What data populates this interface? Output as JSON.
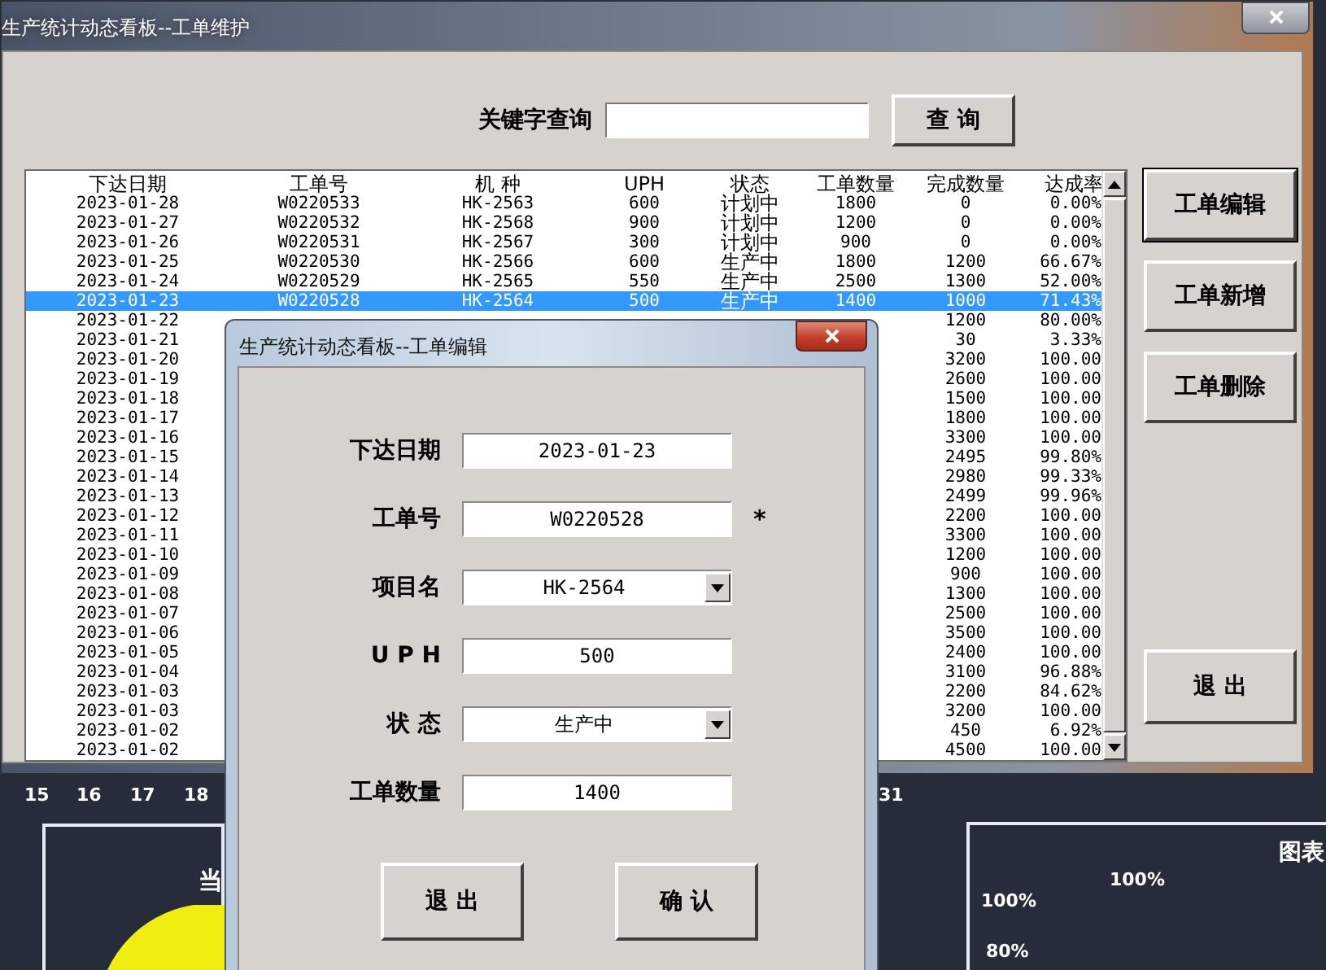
{
  "main_window": {
    "title": "生产统计动态看板--工单维护",
    "search": {
      "label": "关键字查询",
      "button": "查 询"
    },
    "list": {
      "columns": [
        "下达日期",
        "工单号",
        "机 种",
        "UPH",
        "状态",
        "工单数量",
        "完成数量",
        "达成率"
      ],
      "rows": [
        {
          "selected": false,
          "cells": {
            "date": "2023-01-28",
            "order_no": "W0220533",
            "model": "HK-2563",
            "uph": "600",
            "status": "计划中",
            "quantity": "1800",
            "completed": "0",
            "rate": "0.00%"
          }
        },
        {
          "selected": false,
          "cells": {
            "date": "2023-01-27",
            "order_no": "W0220532",
            "model": "HK-2568",
            "uph": "900",
            "status": "计划中",
            "quantity": "1200",
            "completed": "0",
            "rate": "0.00%"
          }
        },
        {
          "selected": false,
          "cells": {
            "date": "2023-01-26",
            "order_no": "W0220531",
            "model": "HK-2567",
            "uph": "300",
            "status": "计划中",
            "quantity": "900",
            "completed": "0",
            "rate": "0.00%"
          }
        },
        {
          "selected": false,
          "cells": {
            "date": "2023-01-25",
            "order_no": "W0220530",
            "model": "HK-2566",
            "uph": "600",
            "status": "生产中",
            "quantity": "1800",
            "completed": "1200",
            "rate": "66.67%"
          }
        },
        {
          "selected": false,
          "cells": {
            "date": "2023-01-24",
            "order_no": "W0220529",
            "model": "HK-2565",
            "uph": "550",
            "status": "生产中",
            "quantity": "2500",
            "completed": "1300",
            "rate": "52.00%"
          }
        },
        {
          "selected": true,
          "cells": {
            "date": "2023-01-23",
            "order_no": "W0220528",
            "model": "HK-2564",
            "uph": "500",
            "status": "生产中",
            "quantity": "1400",
            "completed": "1000",
            "rate": "71.43%"
          }
        },
        {
          "selected": false,
          "cells": {
            "date": "2023-01-22",
            "completed": "1200",
            "rate": "80.00%"
          }
        },
        {
          "selected": false,
          "cells": {
            "date": "2023-01-21",
            "completed": "30",
            "rate": "3.33%"
          }
        },
        {
          "selected": false,
          "cells": {
            "date": "2023-01-20",
            "completed": "3200",
            "rate": "100.00"
          }
        },
        {
          "selected": false,
          "cells": {
            "date": "2023-01-19",
            "completed": "2600",
            "rate": "100.00"
          }
        },
        {
          "selected": false,
          "cells": {
            "date": "2023-01-18",
            "completed": "1500",
            "rate": "100.00"
          }
        },
        {
          "selected": false,
          "cells": {
            "date": "2023-01-17",
            "completed": "1800",
            "rate": "100.00"
          }
        },
        {
          "selected": false,
          "cells": {
            "date": "2023-01-16",
            "completed": "3300",
            "rate": "100.00"
          }
        },
        {
          "selected": false,
          "cells": {
            "date": "2023-01-15",
            "completed": "2495",
            "rate": "99.80%"
          }
        },
        {
          "selected": false,
          "cells": {
            "date": "2023-01-14",
            "completed": "2980",
            "rate": "99.33%"
          }
        },
        {
          "selected": false,
          "cells": {
            "date": "2023-01-13",
            "completed": "2499",
            "rate": "99.96%"
          }
        },
        {
          "selected": false,
          "cells": {
            "date": "2023-01-12",
            "completed": "2200",
            "rate": "100.00"
          }
        },
        {
          "selected": false,
          "cells": {
            "date": "2023-01-11",
            "completed": "3300",
            "rate": "100.00"
          }
        },
        {
          "selected": false,
          "cells": {
            "date": "2023-01-10",
            "completed": "1200",
            "rate": "100.00"
          }
        },
        {
          "selected": false,
          "cells": {
            "date": "2023-01-09",
            "completed": "900",
            "rate": "100.00"
          }
        },
        {
          "selected": false,
          "cells": {
            "date": "2023-01-08",
            "completed": "1300",
            "rate": "100.00"
          }
        },
        {
          "selected": false,
          "cells": {
            "date": "2023-01-07",
            "completed": "2500",
            "rate": "100.00"
          }
        },
        {
          "selected": false,
          "cells": {
            "date": "2023-01-06",
            "completed": "3500",
            "rate": "100.00"
          }
        },
        {
          "selected": false,
          "cells": {
            "date": "2023-01-05",
            "completed": "2400",
            "rate": "100.00"
          }
        },
        {
          "selected": false,
          "cells": {
            "date": "2023-01-04",
            "completed": "3100",
            "rate": "96.88%"
          }
        },
        {
          "selected": false,
          "cells": {
            "date": "2023-01-03",
            "completed": "2200",
            "rate": "84.62%"
          }
        },
        {
          "selected": false,
          "cells": {
            "date": "2023-01-03",
            "completed": "3200",
            "rate": "100.00"
          }
        },
        {
          "selected": false,
          "cells": {
            "date": "2023-01-02",
            "completed": "450",
            "rate": "6.92%"
          }
        },
        {
          "selected": false,
          "cells": {
            "date": "2023-01-02",
            "completed": "4500",
            "rate": "100.00"
          }
        }
      ]
    },
    "actions": [
      {
        "label": "工单编辑",
        "focused": true
      },
      {
        "label": "工单新增",
        "focused": false
      },
      {
        "label": "工单删除",
        "focused": false
      }
    ],
    "exit_button": "退 出"
  },
  "edit_dialog": {
    "title": "生产统计动态看板--工单编辑",
    "fields": [
      {
        "kind": "text",
        "label": "下达日期",
        "value": "2023-01-23"
      },
      {
        "kind": "text",
        "label": "工单号",
        "value": "W0220528",
        "mark": "*"
      },
      {
        "kind": "combo",
        "label": "项目名",
        "value": "HK-2564"
      },
      {
        "kind": "text",
        "label": "U P H",
        "value": "500"
      },
      {
        "kind": "combo",
        "label": "状 态",
        "value": "生产中"
      },
      {
        "kind": "text",
        "label": "工单数量",
        "value": "1400"
      }
    ],
    "buttons": [
      "退 出",
      "确 认"
    ]
  },
  "dashboard": {
    "day_labels": [
      "15",
      "16",
      "17",
      "18",
      "31"
    ],
    "panel_title": "当",
    "chart_title": "图表",
    "chart_labels": [
      "100%",
      "100%",
      "80%"
    ]
  }
}
